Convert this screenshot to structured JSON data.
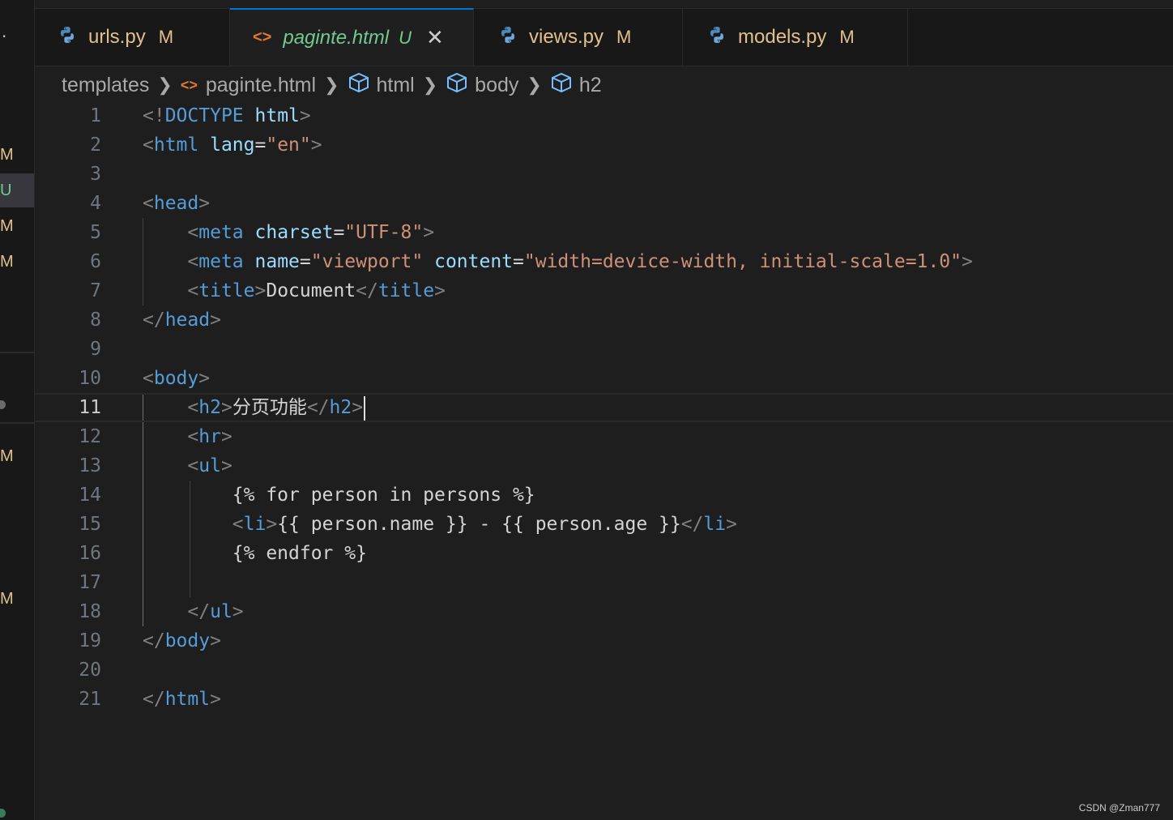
{
  "explorer_strip": {
    "letters": [
      "M",
      "U",
      "M",
      "M",
      "M",
      "M"
    ]
  },
  "tabs": [
    {
      "icon": "python-icon",
      "label": "urls.py",
      "status": "M",
      "active": false
    },
    {
      "icon": "html-icon",
      "label": "paginte.html",
      "status": "U",
      "active": true
    },
    {
      "icon": "python-icon",
      "label": "views.py",
      "status": "M",
      "active": false
    },
    {
      "icon": "python-icon",
      "label": "models.py",
      "status": "M",
      "active": false
    }
  ],
  "breadcrumb": [
    "templates",
    "paginte.html",
    "html",
    "body",
    "h2"
  ],
  "editor": {
    "current_line": 11,
    "line_numbers": [
      "1",
      "2",
      "3",
      "4",
      "5",
      "6",
      "7",
      "8",
      "9",
      "10",
      "11",
      "12",
      "13",
      "14",
      "15",
      "16",
      "17",
      "18",
      "19",
      "20",
      "21"
    ],
    "lines": [
      "<!DOCTYPE html>",
      "<html lang=\"en\">",
      "",
      "<head>",
      "    <meta charset=\"UTF-8\">",
      "    <meta name=\"viewport\" content=\"width=device-width, initial-scale=1.0\">",
      "    <title>Document</title>",
      "</head>",
      "",
      "<body>",
      "    <h2>分页功能</h2>",
      "    <hr>",
      "    <ul>",
      "        {% for person in persons %}",
      "        <li>{{ person.name }} - {{ person.age }}</li>",
      "        {% endfor %}",
      "",
      "    </ul>",
      "</body>",
      "",
      "</html>"
    ]
  },
  "watermark": "CSDN @Zman777",
  "colors": {
    "background": "#1e1e1e",
    "tag": "#569cd6",
    "attribute": "#9cdcfe",
    "string": "#ce9178",
    "punctuation": "#808080",
    "modified": "#e2c08d",
    "untracked": "#73c991"
  }
}
